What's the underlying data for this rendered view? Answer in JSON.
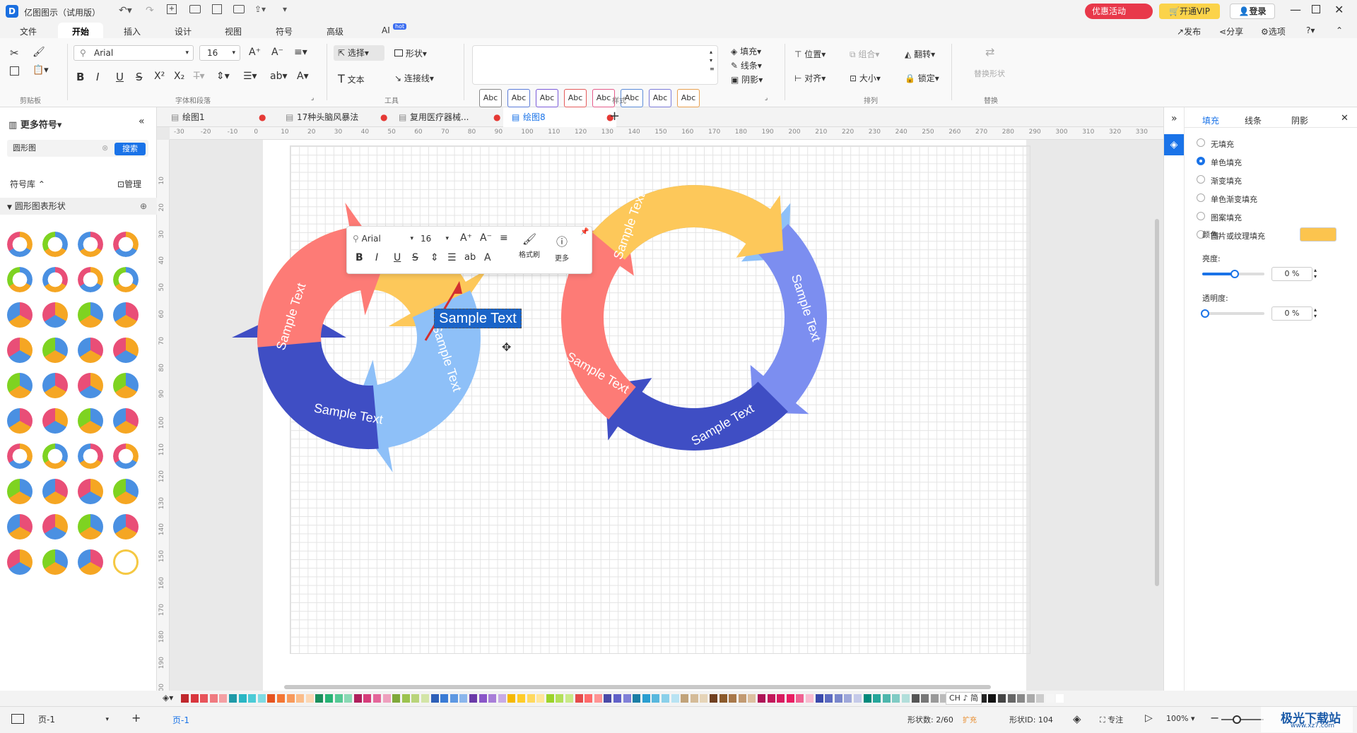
{
  "app": {
    "title": "亿图图示（试用版）",
    "promo": "优惠活动",
    "vip": "开通VIP",
    "login": "登录"
  },
  "menu": {
    "items": [
      "文件",
      "开始",
      "插入",
      "设计",
      "视图",
      "符号",
      "高级",
      "AI"
    ],
    "ai_badge": "hot",
    "right": {
      "publish": "发布",
      "share": "分享",
      "options": "选项"
    }
  },
  "ribbon": {
    "font_name": "Arial",
    "font_size": "16",
    "groups": {
      "clipboard": "剪贴板",
      "font": "字体和段落",
      "tools": "工具",
      "styles": "样式",
      "arrange": "排列",
      "replace": "替换"
    },
    "tools": {
      "select": "选择",
      "shape": "形状",
      "text": "文本",
      "connector": "连接线"
    },
    "style_sample": "Abc",
    "fill": "填充",
    "line": "线条",
    "shadow": "阴影",
    "position": "位置",
    "group": "组合",
    "flip": "翻转",
    "align": "对齐",
    "size": "大小",
    "lock": "锁定",
    "replace_shape": "替换形状"
  },
  "left_panel": {
    "title": "更多符号",
    "search_value": "圆形图",
    "search_button": "搜索",
    "library": "符号库",
    "manage": "管理",
    "category": "圆形图表形状"
  },
  "tabs": [
    {
      "label": "绘图1"
    },
    {
      "label": "17种头脑风暴法"
    },
    {
      "label": "复用医疗器械..."
    },
    {
      "label": "绘图8"
    }
  ],
  "ruler_h": [
    "-30",
    "-20",
    "-10",
    "0",
    "10",
    "20",
    "30",
    "40",
    "50",
    "60",
    "70",
    "80",
    "90",
    "100",
    "110",
    "120",
    "130",
    "140",
    "150",
    "160",
    "170",
    "180",
    "190",
    "200",
    "210",
    "220",
    "230",
    "240",
    "250",
    "260",
    "270",
    "280",
    "290",
    "300",
    "310",
    "320",
    "330"
  ],
  "ruler_v": [
    "10",
    "20",
    "30",
    "40",
    "50",
    "60",
    "70",
    "80",
    "90",
    "100",
    "110",
    "120",
    "130",
    "140",
    "150",
    "160",
    "170",
    "180",
    "190",
    "200"
  ],
  "float_toolbar": {
    "font": "Arial",
    "size": "16",
    "format_painter": "格式刷",
    "more": "更多"
  },
  "diagram": {
    "sample_text": "Sample Text",
    "colors": {
      "yellow": "#fdc85a",
      "blue_light": "#8ec0f8",
      "blue_dark": "#3f4ec4",
      "red": "#fd7b76",
      "periwinkle": "#7c8ef0"
    }
  },
  "right_panel": {
    "tabs": [
      "填充",
      "线条",
      "阴影"
    ],
    "options": [
      "无填充",
      "单色填充",
      "渐变填充",
      "单色渐变填充",
      "图案填充",
      "图片或纹理填充"
    ],
    "selected_index": 1,
    "color_label": "颜色:",
    "color_value": "#fcc44e",
    "brightness_label": "亮度:",
    "brightness_value": "0 %",
    "transparency_label": "透明度:",
    "transparency_value": "0 %"
  },
  "status": {
    "page_select": "页-1",
    "page_tab": "页-1",
    "shape_count": "形状数: 2/60",
    "expand": "扩充",
    "shape_id": "形状ID: 104",
    "focus": "专注",
    "zoom": "100%",
    "ime": "CH ♪ 简"
  },
  "watermark": {
    "text": "极光下载站",
    "url": "www.xz7.com"
  },
  "palette_colors": [
    "#c0282d",
    "#d9363e",
    "#e8545b",
    "#ef7a80",
    "#f4a0a4",
    "#1f9aa8",
    "#29b6c4",
    "#4ccbd6",
    "#7fdbe3",
    "#e6531f",
    "#f47735",
    "#f89a5c",
    "#fbbd8a",
    "#fcd7b4",
    "#1a8f5c",
    "#27b374",
    "#55c994",
    "#8ad9b4",
    "#b01f5c",
    "#d63d7a",
    "#e4679a",
    "#eea0be",
    "#7fa83a",
    "#9cc34f",
    "#b9d47a",
    "#d3e5a7",
    "#2e5fb8",
    "#3a7bd5",
    "#5e98e2",
    "#8bb6ec",
    "#6b3aa8",
    "#8a56c8",
    "#a87ed8",
    "#c8abe6",
    "#f5b800",
    "#ffcc29",
    "#ffd95e",
    "#ffe699",
    "#9bd32a",
    "#b3e05a",
    "#c9ea88",
    "#e54b4b",
    "#ff6b6b",
    "#ff9494",
    "#4a4aa8",
    "#6161c8",
    "#8181d8",
    "#1b7ea5",
    "#2a9ed0",
    "#58b8de",
    "#8ad0ea",
    "#b8e3f3",
    "#c1a37a",
    "#d4bb98",
    "#e6d4b8",
    "#704020",
    "#8b5a2b",
    "#a8784a",
    "#c29a72",
    "#ddc0a0",
    "#ad1457",
    "#c2185b",
    "#d81b60",
    "#e91e63",
    "#f06292",
    "#f8bbd0",
    "#3949ab",
    "#5c6bc0",
    "#7986cb",
    "#9fa8da",
    "#c5cae9",
    "#00897b",
    "#26a69a",
    "#4db6ac",
    "#80cbc4",
    "#b2dfdb",
    "#555555",
    "#777777",
    "#999999",
    "#bbbbbb",
    "#dddddd",
    "#eeeeee",
    "#333333",
    "#222222",
    "#111111",
    "#444444",
    "#666666",
    "#888888",
    "#aaaaaa",
    "#cccccc",
    "#f5f5f5",
    "#ffffff"
  ]
}
